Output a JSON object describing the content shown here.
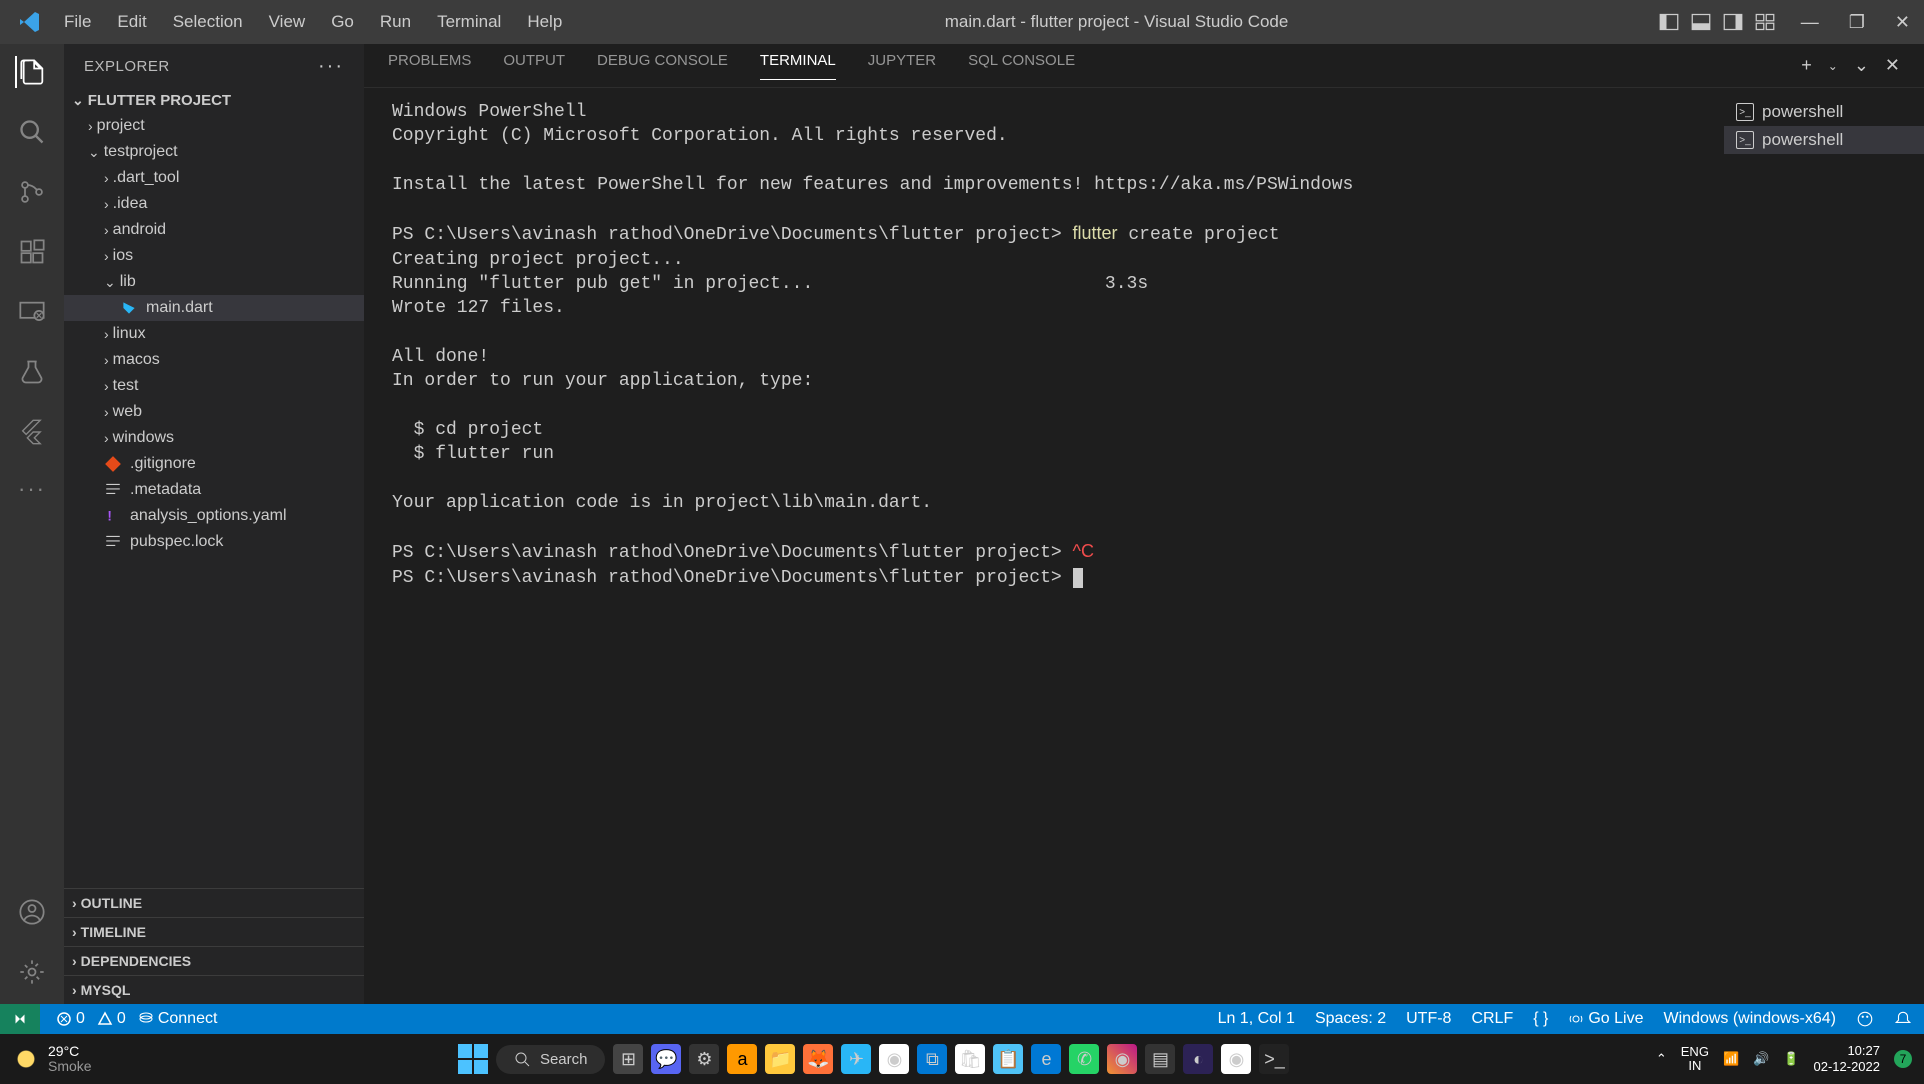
{
  "title": "main.dart - flutter project - Visual Studio Code",
  "menu": [
    "File",
    "Edit",
    "Selection",
    "View",
    "Go",
    "Run",
    "Terminal",
    "Help"
  ],
  "sidebar": {
    "title": "EXPLORER",
    "root": "FLUTTER PROJECT",
    "tree": {
      "project": "project",
      "testproject": "testproject",
      "dart_tool": ".dart_tool",
      "idea": ".idea",
      "android": "android",
      "ios": "ios",
      "lib": "lib",
      "main_dart": "main.dart",
      "linux": "linux",
      "macos": "macos",
      "test": "test",
      "web": "web",
      "windows": "windows",
      "gitignore": ".gitignore",
      "metadata": ".metadata",
      "analysis": "analysis_options.yaml",
      "pubspec_lock": "pubspec.lock"
    },
    "sections": [
      "OUTLINE",
      "TIMELINE",
      "DEPENDENCIES",
      "MYSQL"
    ]
  },
  "panel": {
    "tabs": [
      "PROBLEMS",
      "OUTPUT",
      "DEBUG CONSOLE",
      "TERMINAL",
      "JUPYTER",
      "SQL CONSOLE"
    ],
    "active": "TERMINAL"
  },
  "terminal": {
    "lines": [
      {
        "t": "Windows PowerShell"
      },
      {
        "t": "Copyright (C) Microsoft Corporation. All rights reserved."
      },
      {
        "t": ""
      },
      {
        "t": "Install the latest PowerShell for new features and improvements! https://aka.ms/PSWindows"
      },
      {
        "t": ""
      },
      {
        "prompt": "PS C:\\Users\\avinash rathod\\OneDrive\\Documents\\flutter project> ",
        "cmd": "flutter",
        "rest": " create project"
      },
      {
        "t": "Creating project project..."
      },
      {
        "t": "Running \"flutter pub get\" in project...                           3.3s"
      },
      {
        "t": "Wrote 127 files."
      },
      {
        "t": ""
      },
      {
        "t": "All done!"
      },
      {
        "t": "In order to run your application, type:"
      },
      {
        "t": ""
      },
      {
        "t": "  $ cd project"
      },
      {
        "t": "  $ flutter run"
      },
      {
        "t": ""
      },
      {
        "t": "Your application code is in project\\lib\\main.dart."
      },
      {
        "t": ""
      },
      {
        "prompt": "PS C:\\Users\\avinash rathod\\OneDrive\\Documents\\flutter project> ",
        "err": "^C"
      },
      {
        "prompt": "PS C:\\Users\\avinash rathod\\OneDrive\\Documents\\flutter project> ",
        "cursor": true
      }
    ],
    "shells": [
      "powershell",
      "powershell"
    ]
  },
  "status": {
    "errors": "0",
    "warnings": "0",
    "connect": "Connect",
    "ln_col": "Ln 1, Col 1",
    "spaces": "Spaces: 2",
    "encoding": "UTF-8",
    "eol": "CRLF",
    "lang": "{ }",
    "golive": "Go Live",
    "device": "Windows (windows-x64)"
  },
  "taskbar": {
    "temp": "29°C",
    "weather": "Smoke",
    "search": "Search",
    "lang1": "ENG",
    "lang2": "IN",
    "time": "10:27",
    "date": "02-12-2022",
    "notif": "7"
  }
}
